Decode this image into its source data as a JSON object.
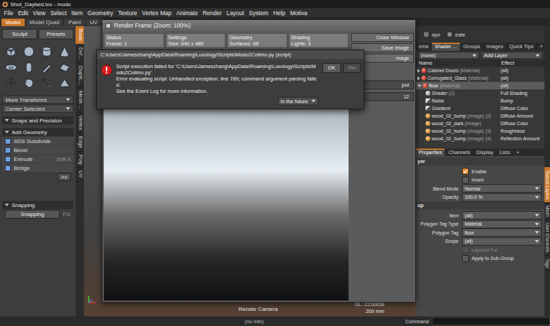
{
  "window": {
    "title": "Shot_Daybed.lxo - modo"
  },
  "menu": [
    "File",
    "Edit",
    "View",
    "Select",
    "Item",
    "Geometry",
    "Texture",
    "Vertex Map",
    "Animate",
    "Render",
    "Layout",
    "System",
    "Help",
    "Motiva"
  ],
  "layout_tabs": [
    {
      "label": "Model",
      "selected": true
    },
    {
      "label": "Model Quad",
      "selected": false
    },
    {
      "label": "Paint",
      "selected": false
    },
    {
      "label": "UV",
      "selected": false
    }
  ],
  "toolbox": {
    "top_buttons": [
      "Sculpt",
      "Presets"
    ],
    "rows": [
      {
        "kind": "dropdown",
        "label": "More Transforms"
      },
      {
        "kind": "dropdown",
        "label": "Center Selected"
      },
      {
        "kind": "section",
        "label": "Snaps and Precision"
      },
      {
        "kind": "section",
        "label": "Add Geometry"
      },
      {
        "kind": "tool",
        "label": "SDS Subdivide"
      },
      {
        "kind": "tool",
        "label": "Bevel"
      },
      {
        "kind": "tool",
        "label": "Extrude",
        "shortcut": "Shift-X"
      },
      {
        "kind": "tool",
        "label": "Bridge"
      },
      {
        "kind": "more",
        "label": ">>"
      },
      {
        "kind": "section",
        "label": "Snapping"
      },
      {
        "kind": "toggle",
        "label": "Snapping",
        "shortcut": "F11"
      }
    ]
  },
  "left_vertical_tabs": [
    {
      "label": "Basic",
      "selected": true
    },
    {
      "label": "Def...",
      "selected": false
    },
    {
      "label": "Duplic...",
      "selected": false
    },
    {
      "label": "Mesh ...",
      "selected": false
    },
    {
      "label": "Vertex",
      "selected": false
    },
    {
      "label": "Edge",
      "selected": false
    },
    {
      "label": "Poly",
      "selected": false
    },
    {
      "label": "UV",
      "selected": false
    }
  ],
  "viewport": {
    "camera": "Render Camera",
    "gl": "GL: 2216858",
    "scale": "200 mm"
  },
  "render_frame": {
    "title": "Render Frame (Zoom: 100%)",
    "stats": [
      {
        "heading": "Status",
        "value": "Frame: 1"
      },
      {
        "heading": "Settings",
        "value": "Size: 640 x 480"
      },
      {
        "heading": "Geometry",
        "value": "Surfaces: 86"
      },
      {
        "heading": "Shading",
        "value": "Lights: 3"
      }
    ],
    "buttons": [
      "Close Window",
      "Save Image",
      "mage"
    ],
    "fields": [
      "put",
      "12"
    ]
  },
  "dialog": {
    "title": "C:\\Users\\Jameszhang\\AppData\\Roaming\\Luxology\\Scripts\\Modo2Colimo.py (script)",
    "lines": [
      "Script execution failed for 'C:\\Users\\Jameszhang\\AppData\\Roaming\\Luxology\\Scripts\\Modo2Colimo.py'",
      "Error evaluating script: Unhandled exception, line 789; command argument parsing failed.",
      "See the Event Log for more information."
    ],
    "future": "In the future",
    "buttons": [
      {
        "label": "OK",
        "disabled": false
      },
      {
        "label": "Ret",
        "disabled": true
      }
    ]
  },
  "right_top": [
    "ayo",
    "eate"
  ],
  "panel_tabs": [
    {
      "label": "ems",
      "selected": false
    },
    {
      "label": "Shader ...",
      "selected": true
    },
    {
      "label": "Groups",
      "selected": false
    },
    {
      "label": "Images",
      "selected": false
    },
    {
      "label": "Quick Tips",
      "selected": false
    },
    {
      "label": "+",
      "selected": false
    }
  ],
  "filter": "(none)",
  "add_layer": "Add Layer",
  "columns": [
    "Name",
    "Effect"
  ],
  "tree": [
    {
      "name": "Cabinet Doors",
      "type": "(Material)",
      "effect": "(all)",
      "depth": 0,
      "kind": "material",
      "expanded": false,
      "selected": false
    },
    {
      "name": "Corrugated_Glass",
      "type": "(Material)",
      "effect": "(all)",
      "depth": 0,
      "kind": "material",
      "expanded": false,
      "selected": false
    },
    {
      "name": "floor",
      "type": "(Material)",
      "effect": "(all)",
      "depth": 0,
      "kind": "material",
      "expanded": true,
      "selected": true
    },
    {
      "name": "Shader",
      "type": "(2)",
      "effect": "Full Shading",
      "depth": 1,
      "kind": "shader",
      "expanded": false,
      "selected": false
    },
    {
      "name": "Noise",
      "effect": "Bump",
      "depth": 1,
      "kind": "texture",
      "expanded": false,
      "selected": false
    },
    {
      "name": "Gradient",
      "effect": "Diffuse Color",
      "depth": 1,
      "kind": "texture",
      "expanded": false,
      "selected": false
    },
    {
      "name": "wood_02_bump",
      "type": "(Image) (2)",
      "effect": "Diffuse Amount",
      "depth": 1,
      "kind": "image",
      "expanded": false,
      "selected": false
    },
    {
      "name": "wood_02_dark",
      "type": "(Image)",
      "effect": "Diffuse Color",
      "depth": 1,
      "kind": "image",
      "expanded": false,
      "selected": false
    },
    {
      "name": "wood_02_bump",
      "type": "(Image) (3)",
      "effect": "Roughness",
      "depth": 1,
      "kind": "image",
      "expanded": false,
      "selected": false
    },
    {
      "name": "wood_02_bump",
      "type": "(Image) (4)",
      "effect": "Reflection Amount",
      "depth": 1,
      "kind": "image",
      "expanded": false,
      "selected": false
    }
  ],
  "prop_tabs": [
    {
      "label": "Properties",
      "selected": true
    },
    {
      "label": "Channels",
      "selected": false
    },
    {
      "label": "Display",
      "selected": false
    },
    {
      "label": "Lists",
      "selected": false
    },
    {
      "label": "+",
      "selected": false
    }
  ],
  "prop_groups": [
    {
      "heading": "yer",
      "fields": [
        {
          "kind": "checkbox",
          "label": "Enable",
          "checked": true,
          "disabled": false
        },
        {
          "kind": "checkbox",
          "label": "Invert",
          "checked": false,
          "disabled": false
        },
        {
          "kind": "select",
          "label": "Blend Mode",
          "value": "Normal"
        },
        {
          "kind": "number",
          "label": "Opacity",
          "value": "100.0 %"
        }
      ]
    },
    {
      "heading": "up",
      "fields": [
        {
          "kind": "select",
          "label": "Item",
          "value": "(all)"
        },
        {
          "kind": "select",
          "label": "Polygon Tag Type",
          "value": "Material"
        },
        {
          "kind": "select",
          "label": "Polygon Tag",
          "value": "floor"
        },
        {
          "kind": "select",
          "label": "Scope",
          "value": "(all)"
        },
        {
          "kind": "checkbox",
          "label": "Layered Fur",
          "checked": false,
          "disabled": true
        },
        {
          "kind": "checkbox",
          "label": "Apply to Sub-Group",
          "checked": false,
          "disabled": false
        }
      ]
    }
  ],
  "right_vertical_tabs": [
    {
      "label": "Texture Layers",
      "selected": true
    },
    {
      "label": "Mesh",
      "selected": false
    },
    {
      "label": "User Channels",
      "selected": false
    },
    {
      "label": "Tags",
      "selected": false
    }
  ],
  "status": {
    "info": "(no info)",
    "command_label": "Command"
  }
}
